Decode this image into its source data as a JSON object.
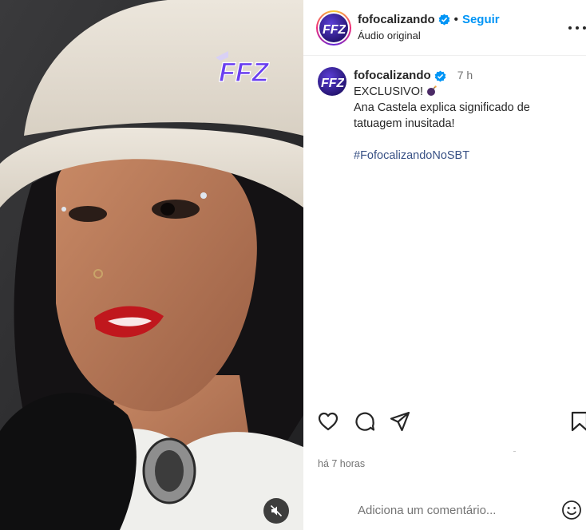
{
  "post": {
    "username": "fofocalizando",
    "follow_label": "Seguir",
    "separator": "•",
    "audio_label": "Áudio original",
    "caption_time": "7 h",
    "caption_lines": [
      "EXCLUSIVO!",
      "Ana Castela explica significado de",
      "tatuagem inusitada!"
    ],
    "hashtag": "#FofocalizandoNoSBT",
    "timestamp": "há 7 horas"
  },
  "comment": {
    "placeholder": "Adiciona um comentário..."
  },
  "video": {
    "watermark_text": "FFZ",
    "muted": true
  },
  "icons": {
    "verified": "verified-badge-icon",
    "bomb": "bomb-emoji-icon",
    "more": "more-options-icon",
    "like": "heart-icon",
    "comment": "comment-bubble-icon",
    "share": "paper-plane-icon",
    "save": "bookmark-icon",
    "emoji": "smiley-icon",
    "mute": "speaker-muted-icon"
  },
  "colors": {
    "follow": "#0095f6",
    "verified": "#0095f6",
    "hashtag": "#385185",
    "brand_purple": "#6a3ff0"
  }
}
